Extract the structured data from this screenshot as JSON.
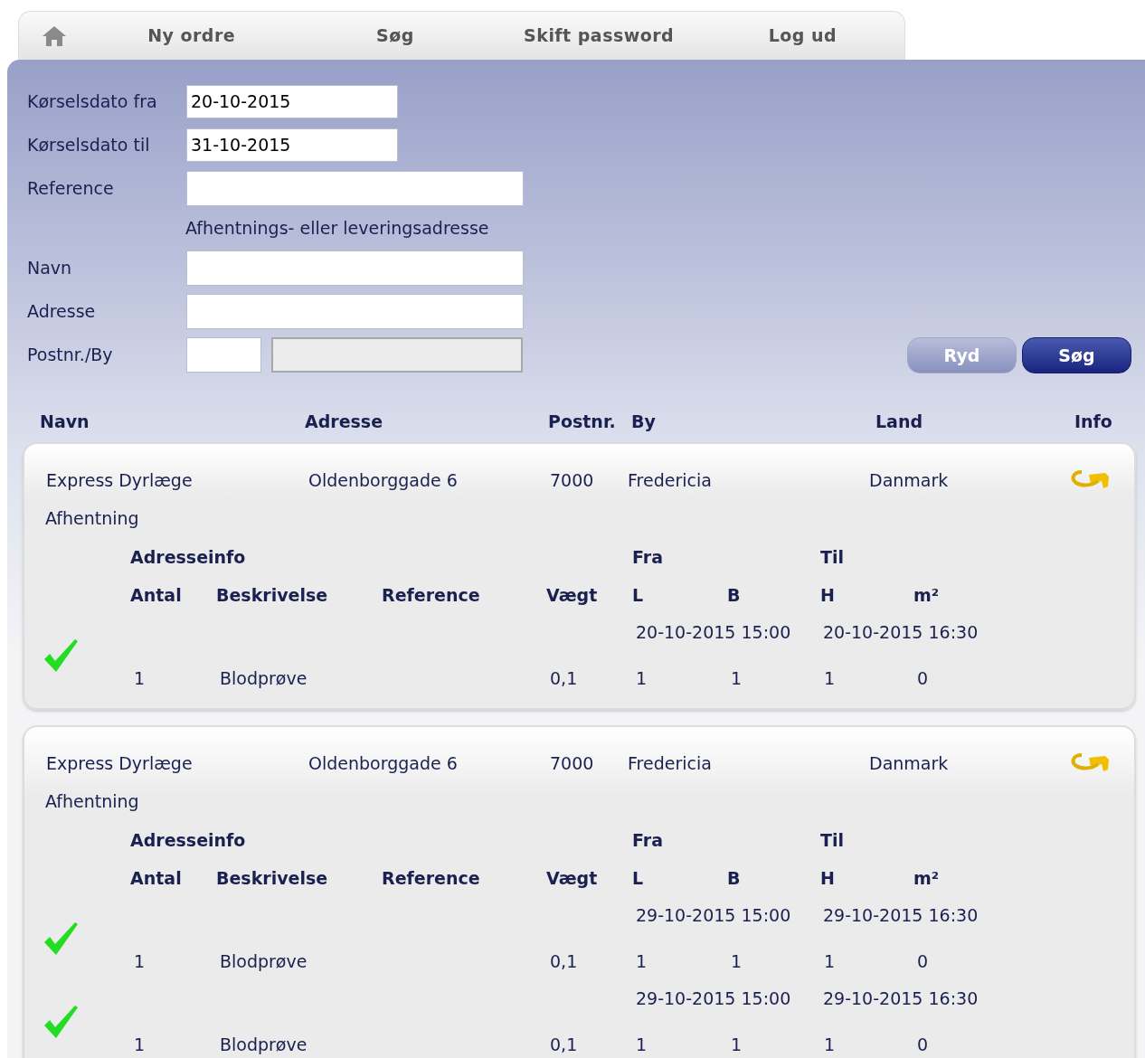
{
  "nav": {
    "items": [
      {
        "kind": "home"
      },
      {
        "kind": "link",
        "label": "Ny ordre"
      },
      {
        "kind": "link",
        "label": "Søg"
      },
      {
        "kind": "link",
        "label": "Skift password"
      },
      {
        "kind": "link",
        "label": "Log ud"
      }
    ]
  },
  "search_form": {
    "fields": [
      {
        "label": "Kørselsdato fra",
        "kind": "date",
        "value": "20-10-2015"
      },
      {
        "label": "Kørselsdato til",
        "kind": "date",
        "value": "31-10-2015"
      },
      {
        "label": "Reference",
        "kind": "text"
      },
      {
        "kind": "note",
        "label": "Afhentnings- eller leveringsadresse"
      },
      {
        "label": "Navn",
        "kind": "text"
      },
      {
        "label": "Adresse",
        "kind": "text"
      },
      {
        "label": "Postnr./By",
        "kind": "postal",
        "disabled_city": true
      }
    ],
    "buttons": [
      {
        "label": "Ryd",
        "kind": "secondary"
      },
      {
        "label": "Søg",
        "kind": "primary"
      }
    ]
  },
  "results": {
    "columns": [
      "Navn",
      "Adresse",
      "Postnr.",
      "By",
      "Land",
      "Info"
    ],
    "rows": [
      {
        "name": "Express Dyrlæge",
        "address": "Oldenborggade 6",
        "postal": "7000",
        "city": "Fredericia",
        "country": "Danmark",
        "type": "Afhentning",
        "group_headers": [
          "Adresseinfo",
          "Fra",
          "Til"
        ],
        "item_columns": [
          "Antal",
          "Beskrivelse",
          "Reference",
          "Vægt",
          "L",
          "B",
          "H",
          "m²"
        ],
        "items": [
          {
            "checked": true,
            "from": "20-10-2015 15:00",
            "to": "20-10-2015 16:30",
            "count": "1",
            "description": "Blodprøve",
            "weight": "0,1",
            "l": "1",
            "b": "1",
            "h": "1",
            "m2": "0"
          }
        ]
      },
      {
        "name": "Express Dyrlæge",
        "address": "Oldenborggade 6",
        "postal": "7000",
        "city": "Fredericia",
        "country": "Danmark",
        "type": "Afhentning",
        "group_headers": [
          "Adresseinfo",
          "Fra",
          "Til"
        ],
        "item_columns": [
          "Antal",
          "Beskrivelse",
          "Reference",
          "Vægt",
          "L",
          "B",
          "H",
          "m²"
        ],
        "items": [
          {
            "checked": true,
            "from": "29-10-2015 15:00",
            "to": "29-10-2015 16:30",
            "count": "1",
            "description": "Blodprøve",
            "weight": "0,1",
            "l": "1",
            "b": "1",
            "h": "1",
            "m2": "0"
          },
          {
            "checked": true,
            "from": "29-10-2015 15:00",
            "to": "29-10-2015 16:30",
            "count": "1",
            "description": "Blodprøve",
            "weight": "0,1",
            "l": "1",
            "b": "1",
            "h": "1",
            "m2": "0"
          }
        ]
      }
    ]
  }
}
